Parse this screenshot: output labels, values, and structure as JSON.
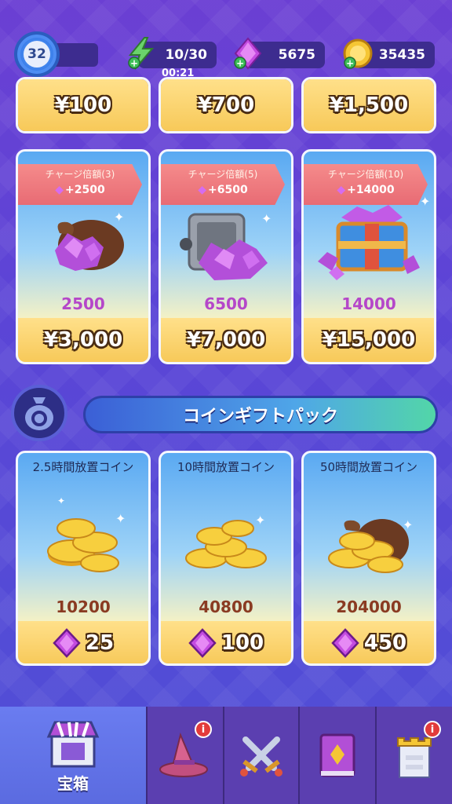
{
  "top": {
    "level": "32",
    "energy": "10/30",
    "energy_timer": "00:21",
    "gems": "5675",
    "coins": "35435"
  },
  "top_row_prices": [
    "¥100",
    "¥700",
    "¥1,500"
  ],
  "gem_packs": [
    {
      "badge_title": "チャージ倍額(3)",
      "bonus": "+2500",
      "amount": "2500",
      "price": "¥3,000"
    },
    {
      "badge_title": "チャージ倍額(5)",
      "bonus": "+6500",
      "amount": "6500",
      "price": "¥7,000"
    },
    {
      "badge_title": "チャージ倍額(10)",
      "bonus": "+14000",
      "amount": "14000",
      "price": "¥15,000"
    }
  ],
  "coin_section_title": "コインギフトパック",
  "coin_packs": [
    {
      "title": "2.5時間放置コイン",
      "amount": "10200",
      "gem_cost": "25"
    },
    {
      "title": "10時間放置コイン",
      "amount": "40800",
      "gem_cost": "100"
    },
    {
      "title": "50時間放置コイン",
      "amount": "204000",
      "gem_cost": "450"
    }
  ],
  "nav": {
    "shop_label": "宝箱",
    "notif": "i"
  },
  "colors": {
    "gem": "#b547c9",
    "coin_text": "#8a3b22",
    "badge": "#e86b74",
    "price_bg": "#f7c959"
  }
}
